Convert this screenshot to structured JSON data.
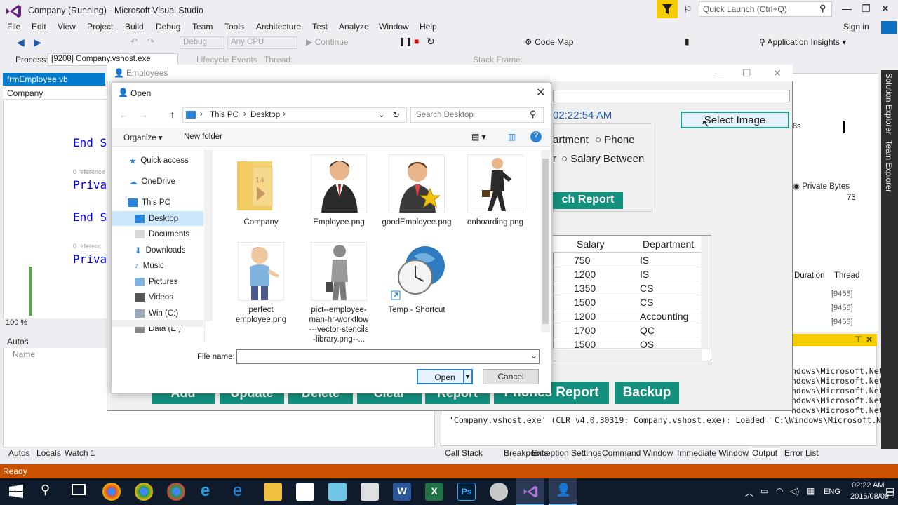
{
  "vs": {
    "title": "Company (Running) - Microsoft Visual Studio",
    "quick_launch_placeholder": "Quick Launch (Ctrl+Q)",
    "sign_in": "Sign in",
    "menu": [
      "File",
      "Edit",
      "View",
      "Project",
      "Build",
      "Debug",
      "Team",
      "Tools",
      "Architecture",
      "Test",
      "Analyze",
      "Window",
      "Help"
    ],
    "toolbar": {
      "config": "Debug",
      "platform": "Any CPU",
      "continue": "Continue",
      "code_map": "Code Map",
      "app_insights": "Application Insights"
    },
    "toolbar2": {
      "process_label": "Process:",
      "process_value": "[9208] Company.vshost.exe",
      "lifecycle": "Lifecycle Events",
      "thread": "Thread:",
      "stack_frame": "Stack Frame:"
    },
    "doc_tab": "frmEmployee.vb",
    "code_nav": "Company",
    "code_lines": [
      "End S",
      "Priva",
      "End S",
      "Priva"
    ],
    "references": [
      "0 reference",
      "0 referenc"
    ],
    "zoom": "100 %",
    "autos": {
      "title": "Autos",
      "col_name": "Name"
    },
    "left_bottom_tabs": [
      "Autos",
      "Locals",
      "Watch 1"
    ],
    "right_bottom_tabs": [
      "Call Stack",
      "Breakpoints",
      "Exception Settings",
      "Command Window",
      "Immediate Window",
      "Output",
      "Error List"
    ],
    "output_lines": [
      "ndows\\Microsoft.Net",
      "ndows\\Microsoft.Net",
      "ndows\\Microsoft.Net",
      "ndows\\Microsoft.Net",
      "ndows\\Microsoft.Net",
      "'Company.vshost.exe' (CLR v4.0.30319: Company.vshost.exe): Loaded 'C:\\Windows\\Microsoft.Net"
    ],
    "side_tabs": [
      "Solution Explorer",
      "Team Explorer"
    ],
    "diag": {
      "seconds": "8s",
      "private_bytes": "Private Bytes",
      "value": "73",
      "duration": "Duration",
      "thread": "Thread",
      "thread_ids": [
        "[9456]",
        "[9456]",
        "[9456]"
      ]
    },
    "status": "Ready"
  },
  "form": {
    "title": "Employees",
    "time": "02:22:54 AM",
    "select_image": "Select Image",
    "radio_labels": [
      "artment",
      "Phone",
      "r",
      "Salary Between"
    ],
    "search_report": "ch Report",
    "grid": {
      "headers": [
        "Salary",
        "Department"
      ],
      "rows": [
        [
          "750",
          "IS"
        ],
        [
          "1200",
          "IS"
        ],
        [
          "1350",
          "CS"
        ],
        [
          "1500",
          "CS"
        ],
        [
          "1200",
          "Accounting"
        ],
        [
          "1700",
          "QC"
        ],
        [
          "1500",
          "OS"
        ]
      ]
    },
    "buttons": [
      "Add",
      "Update",
      "Delete",
      "Clear",
      "Report",
      "Phones Report",
      "Backup"
    ]
  },
  "dialog": {
    "title": "Open",
    "breadcrumb": [
      "This PC",
      "Desktop"
    ],
    "search_placeholder": "Search Desktop",
    "organize": "Organize",
    "new_folder": "New folder",
    "nav": [
      "Quick access",
      "OneDrive",
      "This PC",
      "Desktop",
      "Documents",
      "Downloads",
      "Music",
      "Pictures",
      "Videos",
      "Win (C:)",
      "Data (E:)"
    ],
    "files": [
      {
        "name": "Company"
      },
      {
        "name": "Employee.png"
      },
      {
        "name": "goodEmployee.png"
      },
      {
        "name": "onboarding.png"
      },
      {
        "name": "perfect employee.png"
      },
      {
        "name": "pict--employee-man-hr-workflow---vector-stencils-library.png--..."
      },
      {
        "name": "Temp - Shortcut"
      }
    ],
    "file_name_label": "File name:",
    "file_name_value": "",
    "open_button": "Open",
    "cancel_button": "Cancel"
  },
  "taskbar": {
    "lang": "ENG",
    "time": "02:22 AM",
    "date": "2016/08/09"
  },
  "colors": {
    "vs_accent": "#007acc",
    "status_bar": "#ca5100",
    "form_button": "#13907e",
    "highlight_yellow": "#f5cc00"
  }
}
